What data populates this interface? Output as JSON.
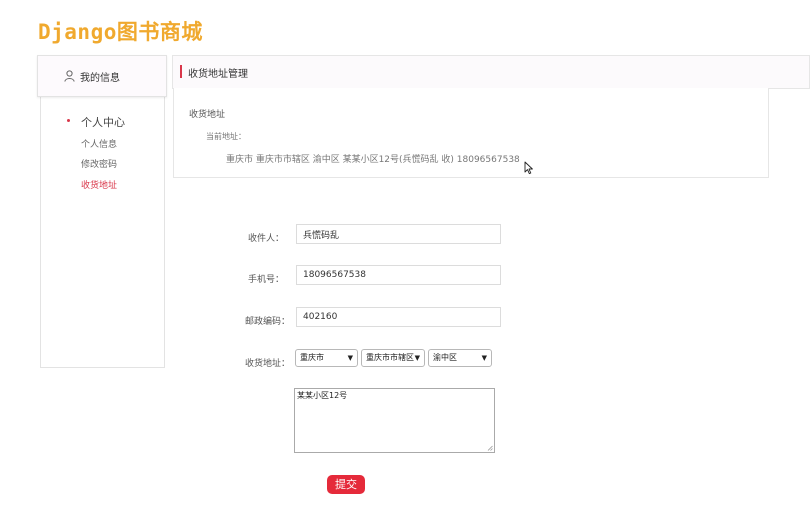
{
  "site": {
    "logo": "Django图书商城"
  },
  "sidebar": {
    "header": "我的信息",
    "section": "个人中心",
    "links": [
      {
        "label": "个人信息",
        "active": false
      },
      {
        "label": "修改密码",
        "active": false
      },
      {
        "label": "收货地址",
        "active": true
      }
    ]
  },
  "panel": {
    "header": "收货地址管理",
    "section_title": "收货地址",
    "current_label": "当前地址：",
    "current_address": "重庆市 重庆市市辖区 渝中区 某某小区12号(兵慌码乱 收) 18096567538"
  },
  "form": {
    "receiver_label": "收件人：",
    "receiver_value": "兵慌码乱",
    "phone_label": "手机号：",
    "phone_value": "18096567538",
    "zip_label": "邮政编码：",
    "zip_value": "402160",
    "region_label": "收货地址：",
    "province": "重庆市",
    "city": "重庆市市辖区",
    "district": "渝中区",
    "detail_address": "某某小区12号",
    "submit_label": "提交"
  },
  "colors": {
    "accent": "#d9374a",
    "logo": "#f0a92e",
    "submit": "#e52a3a"
  }
}
